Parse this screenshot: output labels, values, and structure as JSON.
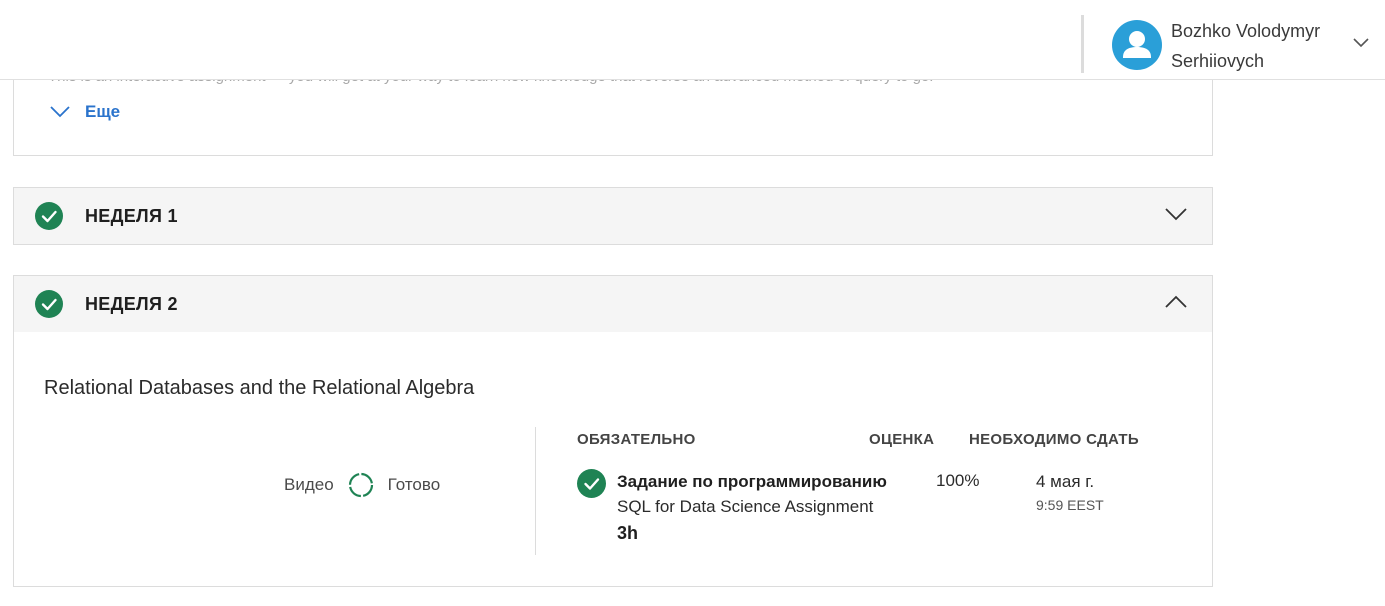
{
  "header": {
    "user_name": "Bozhko Volodymyr Serhiiovych"
  },
  "description": {
    "text": "This is an interactive assignment — you will get at your way to learn new knowledge that reverse an advanced method of query to go.",
    "more_label": "Еще"
  },
  "weeks": [
    {
      "title": "НЕДЕЛЯ 1",
      "completed": true,
      "expanded": false
    },
    {
      "title": "НЕДЕЛЯ 2",
      "completed": true,
      "expanded": true,
      "lesson_title": "Relational Databases and the Relational Algebra",
      "progress": {
        "left_label": "Видео",
        "right_label": "Готово"
      },
      "columns": {
        "required": "ОБЯЗАТЕЛЬНО",
        "grade": "ОЦЕНКА",
        "due": "НЕОБХОДИМО СДАТЬ"
      },
      "items": [
        {
          "type": "Задание по программированию",
          "name": "SQL for Data Science Assignment",
          "duration": "3h",
          "grade": "100%",
          "due_date": "4 мая г.",
          "due_time": "9:59 EEST",
          "completed": true
        }
      ]
    }
  ],
  "colors": {
    "accent_blue": "#2a73cc",
    "success_green": "#1f8354",
    "avatar_blue": "#2a9fd8"
  },
  "icons": {
    "avatar": "user-icon",
    "user_menu": "chevron-down-icon",
    "more": "chevron-down-icon",
    "week_status": "check-circle-icon",
    "week1_toggle": "chevron-down-icon",
    "week2_toggle": "chevron-up-icon",
    "progress": "progress-ring-icon"
  }
}
